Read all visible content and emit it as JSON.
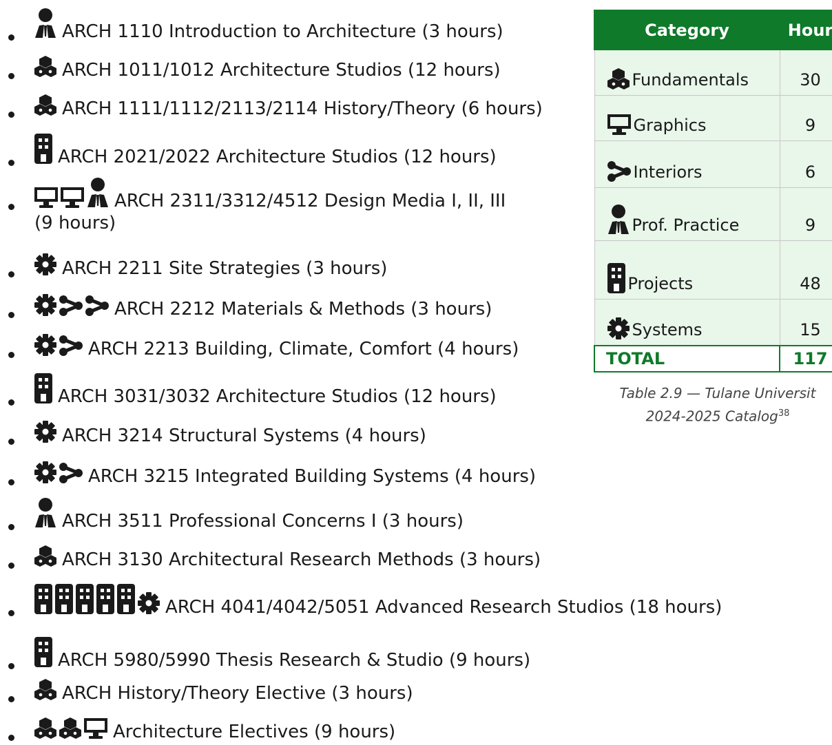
{
  "courses": [
    {
      "icons": [
        "person-icon"
      ],
      "text": "ARCH 1110 Introduction to Architecture (3 hours)"
    },
    {
      "icons": [
        "cubes-icon"
      ],
      "text": "ARCH 1011/1012 Architecture Studios (12 hours)"
    },
    {
      "icons": [
        "cubes-icon"
      ],
      "text": "ARCH 1111/1112/2113/2114 History/Theory (6 hours)"
    },
    {
      "icons": [
        "building-icon"
      ],
      "text": "ARCH 2021/2022 Architecture Studios (12 hours)"
    },
    {
      "icons": [
        "monitor-icon",
        "monitor-icon",
        "person-icon"
      ],
      "text": "ARCH 2311/3312/4512 Design Media I, II, III",
      "text2": "(9 hours)"
    },
    {
      "icons": [
        "gear-icon"
      ],
      "text": "ARCH 2211 Site Strategies (3 hours)"
    },
    {
      "icons": [
        "gear-icon",
        "chevron-icon",
        "chevron-icon"
      ],
      "text": "ARCH 2212 Materials & Methods (3 hours)"
    },
    {
      "icons": [
        "gear-icon",
        "chevron-icon"
      ],
      "text": "ARCH 2213 Building, Climate, Comfort (4 hours)"
    },
    {
      "icons": [
        "building-icon"
      ],
      "text": "ARCH 3031/3032 Architecture Studios (12 hours)"
    },
    {
      "icons": [
        "gear-icon"
      ],
      "text": "ARCH 3214 Structural Systems (4 hours)"
    },
    {
      "icons": [
        "gear-icon",
        "chevron-icon"
      ],
      "text": "ARCH 3215 Integrated Building Systems (4 hours)"
    },
    {
      "icons": [
        "person-icon"
      ],
      "text": "ARCH 3511 Professional Concerns I (3 hours)"
    },
    {
      "icons": [
        "cubes-icon"
      ],
      "text": "ARCH 3130 Architectural Research Methods (3 hours)"
    },
    {
      "icons": [
        "building-icon",
        "building-icon",
        "building-icon",
        "building-icon",
        "building-icon",
        "gear-icon"
      ],
      "text": "ARCH 4041/4042/5051 Advanced Research Studios (18 hours)"
    },
    {
      "icons": [
        "building-icon"
      ],
      "text": "ARCH 5980/5990 Thesis Research & Studio (9 hours)"
    },
    {
      "icons": [
        "cubes-icon"
      ],
      "text": "ARCH History/Theory Elective (3 hours)"
    },
    {
      "icons": [
        "cubes-icon",
        "cubes-icon",
        "monitor-icon"
      ],
      "text": "Architecture Electives (9 hours)"
    }
  ],
  "table": {
    "header": {
      "category": "Category",
      "hours": "Hour"
    },
    "rows": [
      {
        "icon": "cubes-icon",
        "category": "Fundamentals",
        "hours": "30"
      },
      {
        "icon": "monitor-icon",
        "category": "Graphics",
        "hours": "9"
      },
      {
        "icon": "chevron-icon",
        "category": "Interiors",
        "hours": "6"
      },
      {
        "icon": "person-icon",
        "category": "Prof. Practice",
        "hours": "9"
      },
      {
        "icon": "building-icon",
        "category": "Projects",
        "hours": "48"
      },
      {
        "icon": "gear-icon",
        "category": "Systems",
        "hours": "15"
      }
    ],
    "total": {
      "category": "TOTAL",
      "hours": "117"
    }
  },
  "caption": {
    "line1": "Table 2.9 — Tulane Universit",
    "line2": "2024-2025 Catalog",
    "footnote": "38"
  },
  "colors": {
    "header_green": "#0f7a2a",
    "row_bg": "#e9f6ea"
  }
}
